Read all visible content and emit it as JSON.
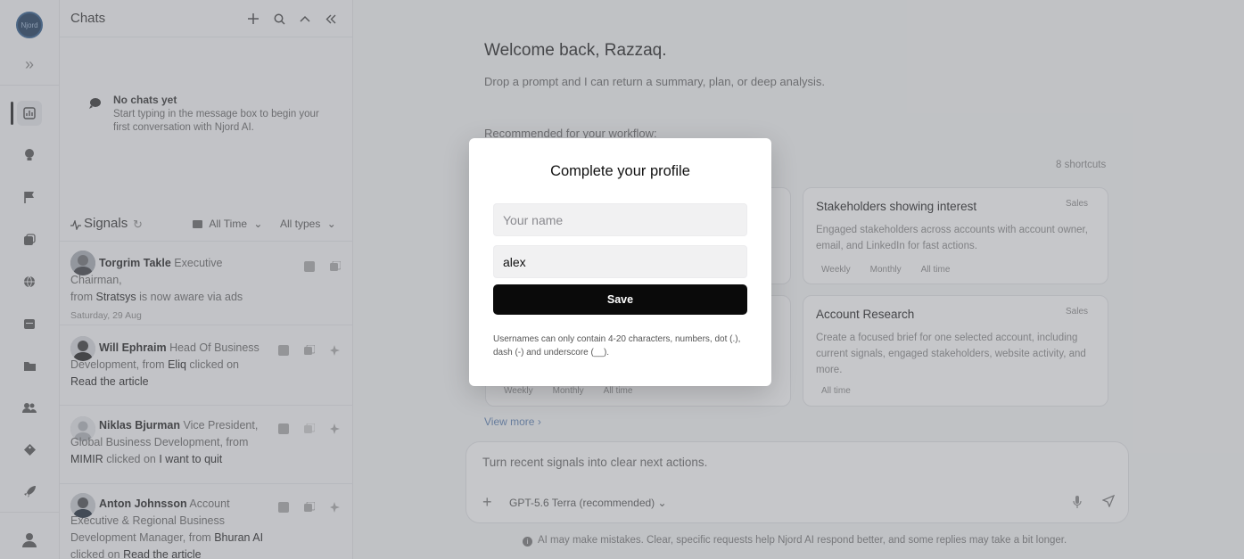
{
  "rail": {
    "logo_text": "Njord",
    "items": [
      "dashboard-icon",
      "lightbulb-icon",
      "flag-icon",
      "copy-icon",
      "globe-icon",
      "calendar-icon",
      "folder-icon",
      "people-icon",
      "tag-icon",
      "rocket-icon"
    ]
  },
  "chats": {
    "title": "Chats",
    "empty_title": "No chats yet",
    "empty_text": "Start typing in the message box to begin your first conversation with Njord AI."
  },
  "signals": {
    "title": "Signals",
    "time_filter": "All Time",
    "type_filter": "All types",
    "date_separator": "Saturday, 29 Aug",
    "items": [
      {
        "name": "Torgrim Takle",
        "role": " Executive Chairman,",
        "from_prefix": "from ",
        "company": "Stratsys",
        "action": " is now aware via ads",
        "target": ""
      },
      {
        "name": "Will Ephraim",
        "role": " Head Of Business Development,",
        "from_prefix": " from ",
        "company": "Eliq",
        "action": " clicked on ",
        "target": "Read the article"
      },
      {
        "name": "Niklas Bjurman",
        "role": " Vice President, Global Business Development,",
        "from_prefix": " from ",
        "company": "MIMIR",
        "action": " clicked on ",
        "target": "I want to quit"
      },
      {
        "name": "Anton Johnsson",
        "role": " Account Executive & Regional Business Development Manager,",
        "from_prefix": " from ",
        "company": "Bhuran AI",
        "action": " clicked on ",
        "target": "Read the article"
      }
    ]
  },
  "main": {
    "welcome": "Welcome back, Razzaq.",
    "subtitle": "Drop a prompt and I can return a summary, plan, or deep analysis.",
    "recommended": "Recommended for your workflow:",
    "shortcuts_count": "8 shortcuts",
    "cards": [
      {
        "title": "Stakeholders showing interest",
        "tag": "Sales",
        "desc": "Engaged stakeholders across accounts with account owner, email, and LinkedIn for fast actions.",
        "pills": [
          "Weekly",
          "Monthly",
          "All time"
        ]
      },
      {
        "title": "Account Research",
        "tag": "Sales",
        "desc": "Create a focused brief for one selected account, including current signals, engaged stakeholders, website activity, and more.",
        "pills": [
          "All time"
        ]
      }
    ],
    "left_card_pills": [
      "Weekly",
      "Monthly",
      "All time"
    ],
    "view_more": "View more",
    "composer_placeholder": "Turn recent signals into clear next actions.",
    "model": "GPT-5.6 Terra (recommended)",
    "disclaimer": "AI may make mistakes. Clear, specific requests help Njord AI respond better, and some replies may take a bit longer."
  },
  "modal": {
    "title": "Complete your profile",
    "name_placeholder": "Your name",
    "name_value": "",
    "username_value": "alex",
    "save_label": "Save",
    "hint": "Usernames can only contain 4-20 characters, numbers, dot (.), dash (-) and underscore (__)."
  }
}
